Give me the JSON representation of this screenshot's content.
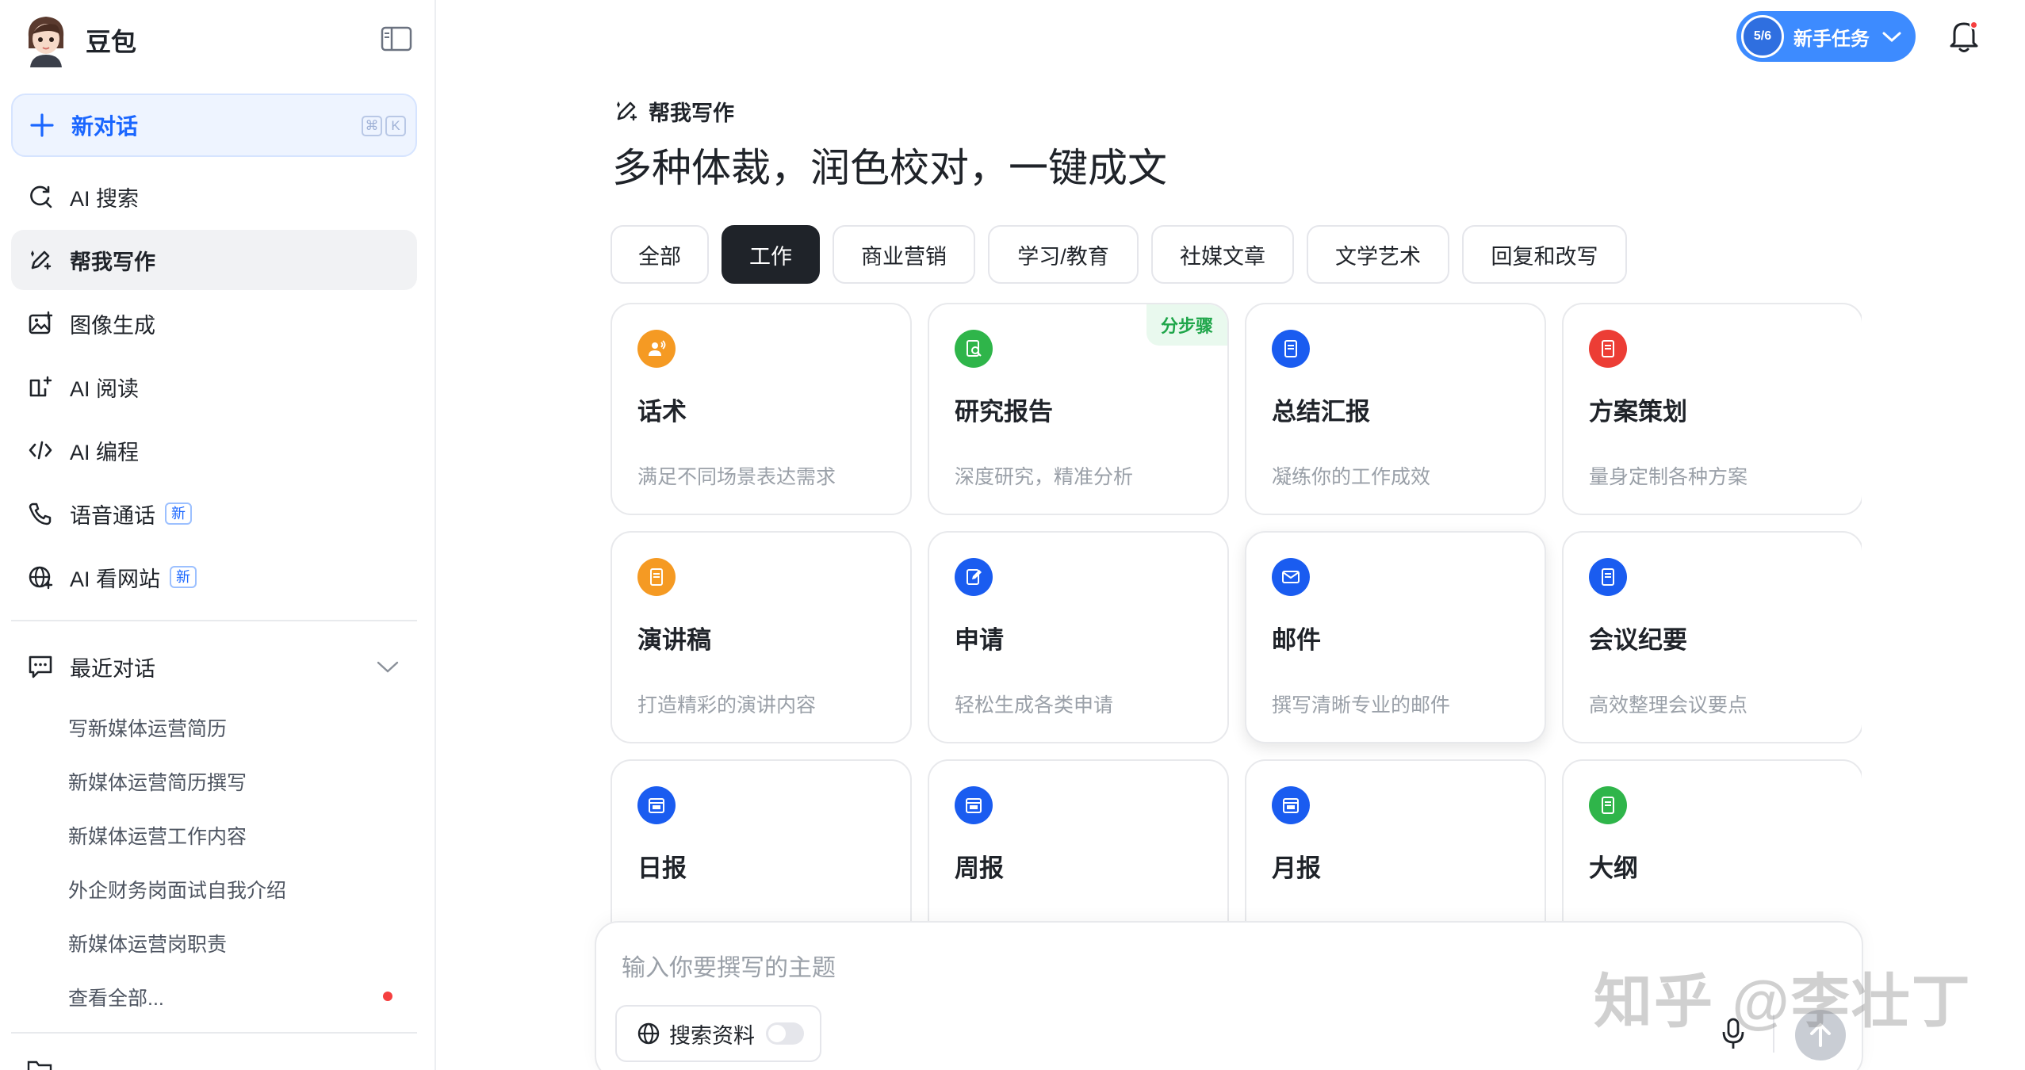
{
  "sidebar": {
    "brand_name": "豆包",
    "new_chat": {
      "label": "新对话",
      "shortcut": [
        "⌘",
        "K"
      ]
    },
    "nav": [
      {
        "label": "AI 搜索",
        "icon": "search-refresh-icon"
      },
      {
        "label": "帮我写作",
        "icon": "pen-sparkle-icon",
        "active": true
      },
      {
        "label": "图像生成",
        "icon": "image-gen-icon"
      },
      {
        "label": "AI 阅读",
        "icon": "book-reader-icon"
      },
      {
        "label": "AI 编程",
        "icon": "code-icon"
      },
      {
        "label": "语音通话",
        "icon": "phone-icon",
        "badge": "新"
      },
      {
        "label": "AI 看网站",
        "icon": "globe-icon",
        "badge": "新"
      }
    ],
    "recent": {
      "title": "最近对话",
      "items": [
        "写新媒体运营简历",
        "新媒体运营简历撰写",
        "新媒体运营工作内容",
        "外企财务岗面试自我介绍",
        "新媒体运营岗职责",
        "查看全部..."
      ]
    }
  },
  "topbar": {
    "task_progress": "5/6",
    "task_label": "新手任务"
  },
  "main": {
    "crumb": "帮我写作",
    "headline": "多种体裁，润色校对，一键成文",
    "tabs": [
      "全部",
      "工作",
      "商业营销",
      "学习/教育",
      "社媒文章",
      "文学艺术",
      "回复和改写"
    ],
    "active_tab": "工作",
    "cards": [
      {
        "title": "话术",
        "desc": "满足不同场景表达需求",
        "color": "#f59a23",
        "icon": "speech-icon"
      },
      {
        "title": "研究报告",
        "desc": "深度研究，精准分析",
        "color": "#2fb54a",
        "icon": "research-doc-icon",
        "tag": "分步骤"
      },
      {
        "title": "总结汇报",
        "desc": "凝练你的工作成效",
        "color": "#1a5cf0",
        "icon": "doc-icon"
      },
      {
        "title": "方案策划",
        "desc": "量身定制各种方案",
        "color": "#ec3d35",
        "icon": "doc-icon"
      },
      {
        "title": "演讲稿",
        "desc": "打造精彩的演讲内容",
        "color": "#f59a23",
        "icon": "doc-icon"
      },
      {
        "title": "申请",
        "desc": "轻松生成各类申请",
        "color": "#1a5cf0",
        "icon": "edit-doc-icon"
      },
      {
        "title": "邮件",
        "desc": "撰写清晰专业的邮件",
        "color": "#1a5cf0",
        "icon": "mail-icon"
      },
      {
        "title": "会议纪要",
        "desc": "高效整理会议要点",
        "color": "#1a5cf0",
        "icon": "doc-icon"
      },
      {
        "title": "日报",
        "desc": "",
        "color": "#1a5cf0",
        "icon": "calendar-icon"
      },
      {
        "title": "周报",
        "desc": "",
        "color": "#1a5cf0",
        "icon": "calendar-icon"
      },
      {
        "title": "月报",
        "desc": "",
        "color": "#1a5cf0",
        "icon": "calendar-icon"
      },
      {
        "title": "大纲",
        "desc": "",
        "color": "#2fb54a",
        "icon": "doc-icon"
      }
    ]
  },
  "composer": {
    "placeholder": "输入你要撰写的主题",
    "search_label": "搜索资料"
  },
  "watermark": "知乎 @李壮丁"
}
